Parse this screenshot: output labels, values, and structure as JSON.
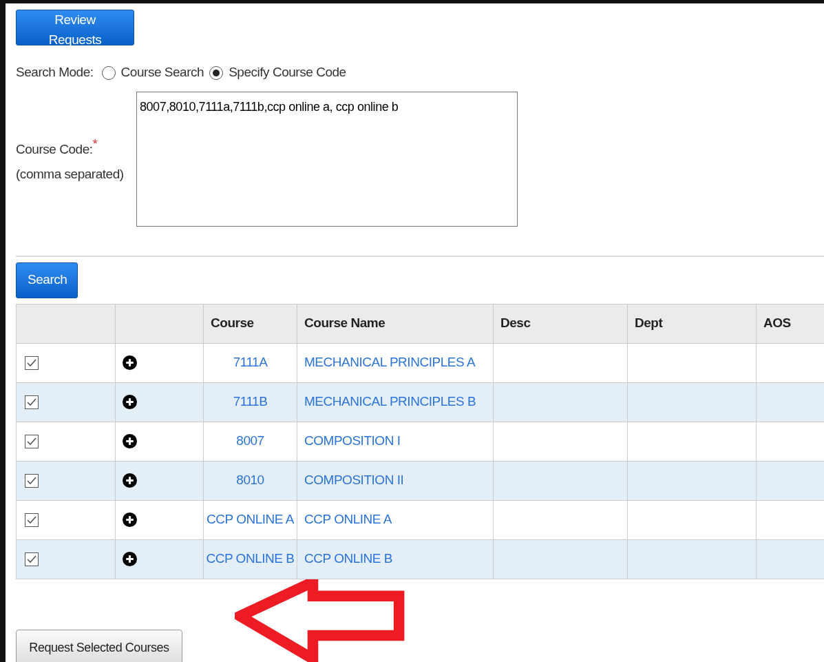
{
  "review_button": "Review Requests",
  "search_mode": {
    "label": "Search Mode:",
    "options": [
      {
        "label": "Course Search",
        "selected": false
      },
      {
        "label": "Specify Course Code",
        "selected": true
      }
    ]
  },
  "course_code": {
    "label": "Course Code:",
    "required_mark": "*",
    "hint": "(comma separated)",
    "value": "8007,8010,7111a,7111b,ccp online a, ccp online b"
  },
  "search_button": "Search",
  "table": {
    "columns": [
      "",
      "",
      "Course",
      "Course Name",
      "Desc",
      "Dept",
      "AOS"
    ],
    "rows": [
      {
        "checked": true,
        "course": "7111A",
        "course_name": "MECHANICAL PRINCIPLES A"
      },
      {
        "checked": true,
        "course": "7111B",
        "course_name": "MECHANICAL PRINCIPLES B"
      },
      {
        "checked": true,
        "course": "8007",
        "course_name": "COMPOSITION I"
      },
      {
        "checked": true,
        "course": "8010",
        "course_name": "COMPOSITION II"
      },
      {
        "checked": true,
        "course": "CCP ONLINE A",
        "course_name": "CCP ONLINE A"
      },
      {
        "checked": true,
        "course": "CCP ONLINE B",
        "course_name": "CCP ONLINE B"
      }
    ]
  },
  "request_button": "Request Selected Courses"
}
